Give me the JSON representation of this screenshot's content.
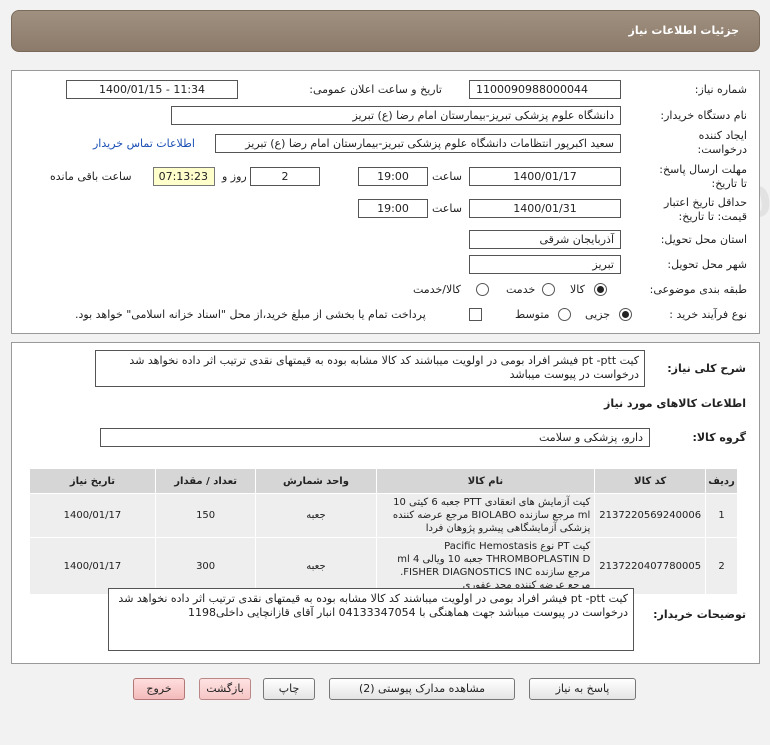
{
  "header": {
    "title": "جزئیات اطلاعات نیاز"
  },
  "form": {
    "need_number_label": "شماره نیاز:",
    "need_number": "1100090988000044",
    "announce_label": "تاریخ و ساعت اعلان عمومی:",
    "announce_value": "1400/01/15 - 11:34",
    "buyer_label": "نام دستگاه خریدار:",
    "buyer_value": "دانشگاه علوم پزشکی تبریز-بیمارستان امام رضا (ع) تبریز",
    "creator_label_1": "ایجاد کننده",
    "creator_label_2": "درخواست:",
    "creator_value": "سعید اکبرپور انتظامات دانشگاه علوم پزشکی تبریز-بیمارستان امام رضا (ع) تبریز",
    "contact_link": "اطلاعات تماس خریدار",
    "deadline_label_1": "مهلت ارسال پاسخ:",
    "deadline_label_2": "تا تاریخ:",
    "deadline_date": "1400/01/17",
    "time_label": "ساعت",
    "deadline_time": "19:00",
    "days_value": "2",
    "days_label": "روز و",
    "remaining_time": "07:13:23",
    "remaining_label": "ساعت باقی مانده",
    "validity_label_1": "حداقل تاریخ اعتبار",
    "validity_label_2": "قیمت: تا تاریخ:",
    "validity_date": "1400/01/31",
    "validity_time": "19:00",
    "province_label": "استان محل تحویل:",
    "province_value": "آذربایجان شرقی",
    "city_label": "شهر محل تحویل:",
    "city_value": "تبریز",
    "category_label": "طبقه بندی موضوعی:",
    "category_options": [
      "کالا",
      "خدمت",
      "کالا/خدمت"
    ],
    "process_label": "نوع فرآیند خرید :",
    "process_options": [
      "جزیی",
      "متوسط"
    ],
    "payment_note": "پرداخت تمام یا بخشی از مبلغ خرید،از محل \"اسناد خزانه اسلامی\" خواهد بود."
  },
  "summary": {
    "label": "شرح کلی نیاز:",
    "text": "کیت pt -ptt فیشر افراد بومی در اولویت میباشند کد کالا مشابه بوده به قیمتهای نقدی ترتیب اثر داده نخواهد شد درخواست در پیوست میباشد"
  },
  "goods": {
    "section_title": "اطلاعات کالاهای مورد نیاز",
    "group_label": "گروه کالا:",
    "group_value": "دارو، پزشکی و سلامت",
    "columns": [
      "ردیف",
      "کد کالا",
      "نام کالا",
      "واحد شمارش",
      "تعداد / مقدار",
      "تاریخ نیاز"
    ],
    "rows": [
      {
        "row": "1",
        "code": "2137220569240006",
        "name": "کیت آزمایش های انعقادی PTT جعبه 6 کیتی 10 ml مرجع سازنده BIOLABO مرجع عرضه کننده پزشکی آزمایشگاهی پیشرو پژوهان فردا",
        "unit": "جعبه",
        "qty": "150",
        "date": "1400/01/17"
      },
      {
        "row": "2",
        "code": "2137220407780005",
        "name": "کیت PT نوع Pacific Hemostasis THROMBOPLASTIN D جعبه 10 ویالی 4 ml مرجع سازنده FISHER DIAGNOSTICS INC. مرجع عرضه کننده مجد عفوری",
        "unit": "جعبه",
        "qty": "300",
        "date": "1400/01/17"
      }
    ]
  },
  "buyer_notes": {
    "label": "توضیحات خریدار:",
    "text": "کیت pt -ptt فیشر افراد بومی در اولویت میباشند کد کالا مشابه بوده به قیمتهای نقدی ترتیب اثر داده نخواهد شد درخواست در پیوست میباشد جهت هماهنگی با 04133347054 انبار آقای قازانچایی داخلی1198"
  },
  "buttons": {
    "reply": "پاسخ به نیاز",
    "attachments": "مشاهده مدارک پیوستی (2)",
    "print": "چاپ",
    "back": "بازگشت",
    "exit": "خروج"
  }
}
